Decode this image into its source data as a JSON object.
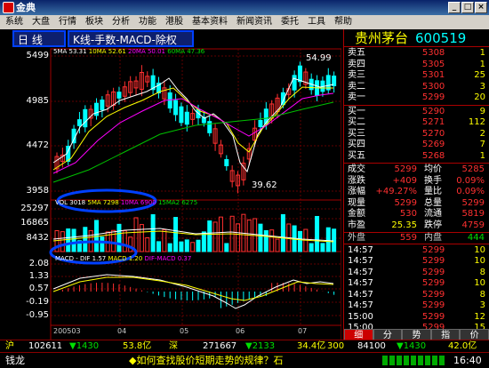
{
  "window": {
    "title": "金典",
    "min": "_",
    "max": "□",
    "close": "×"
  },
  "menu": [
    "系统",
    "大盘",
    "行情",
    "板块",
    "分析",
    "功能",
    "港股",
    "基本资料",
    "新闻资讯",
    "委托",
    "工具",
    "帮助"
  ],
  "chart_header": {
    "period": "日 线",
    "indicator": "K线-手数-MACD-除权"
  },
  "stock": {
    "name": "贵州茅台",
    "code": "600519"
  },
  "price_axis": [
    "5499",
    "4985",
    "4472",
    "3958"
  ],
  "vol_axis": [
    "25297",
    "16865",
    "8432"
  ],
  "macd_axis": [
    "2.08",
    "1.33",
    "0.57",
    "-0.19",
    "-0.95"
  ],
  "ma_legend": {
    "ma5": "5MA 53.31",
    "ma10": "10MA 52.61",
    "ma20": "20MA 50.01",
    "ma60": "60MA 47.36"
  },
  "vol_legend": {
    "vol": "VOL 3018",
    "ma5": "5MA 7298",
    "ma10": "10MA 6900",
    "ma15": "15MA2 6275"
  },
  "macd_legend": {
    "dif": "MACD - DIF 1.57",
    "dea": "MACD 1.20",
    "diff": "DIF-MACD 0.37"
  },
  "marks": {
    "high": "54.99",
    "low": "39.62"
  },
  "date_axis": [
    "200503",
    "04",
    "05",
    "06",
    "07"
  ],
  "ask": [
    {
      "label": "卖五",
      "price": "5308",
      "vol": "1"
    },
    {
      "label": "卖四",
      "price": "5305",
      "vol": "1"
    },
    {
      "label": "卖三",
      "price": "5301",
      "vol": "25"
    },
    {
      "label": "卖二",
      "price": "5300",
      "vol": "3"
    },
    {
      "label": "卖一",
      "price": "5299",
      "vol": "20"
    }
  ],
  "bid": [
    {
      "label": "买一",
      "price": "5290",
      "vol": "9"
    },
    {
      "label": "买二",
      "price": "5271",
      "vol": "112"
    },
    {
      "label": "买三",
      "price": "5270",
      "vol": "2"
    },
    {
      "label": "买四",
      "price": "5269",
      "vol": "7"
    },
    {
      "label": "买五",
      "price": "5268",
      "vol": "1"
    }
  ],
  "stats": [
    {
      "l1": "成交",
      "v1": "5299",
      "l2": "均价",
      "v2": "5285"
    },
    {
      "l1": "涨跌",
      "v1": "+409",
      "l2": "换手",
      "v2": "0.09%"
    },
    {
      "l1": "涨幅",
      "v1": "+49.27%",
      "l2": "量比",
      "v2": "0.09%"
    },
    {
      "l1": "现量",
      "v1": "5299",
      "l2": "总量",
      "v2": "5299"
    },
    {
      "l1": "金额",
      "v1": "530",
      "l2": "流通",
      "v2": "5819"
    },
    {
      "l1": "市盈",
      "v1": "25.35",
      "l2": "跌停",
      "v2": "4759"
    }
  ],
  "outin": {
    "out_label": "外盘",
    "out": "559",
    "in_label": "内盘",
    "in": "444"
  },
  "ticks": [
    {
      "time": "14:57",
      "price": "5299",
      "vol": "10"
    },
    {
      "time": "14:57",
      "price": "5299",
      "vol": "10"
    },
    {
      "time": "14:57",
      "price": "5299",
      "vol": "8"
    },
    {
      "time": "14:57",
      "price": "5299",
      "vol": "10"
    },
    {
      "time": "14:57",
      "price": "5299",
      "vol": "8"
    },
    {
      "time": "14:57",
      "price": "5299",
      "vol": "3"
    },
    {
      "time": "15:00",
      "price": "5299",
      "vol": "12"
    },
    {
      "time": "15:00",
      "price": "5299",
      "vol": "15"
    },
    {
      "time": "15:00",
      "price": "5299",
      "vol": "1"
    }
  ],
  "right_tabs": [
    "细",
    "分",
    "势",
    "指",
    "价"
  ],
  "indexbar": {
    "sh_label": "沪",
    "sh_val": "102611",
    "sh_chg": "▼1430",
    "sh_amt": "53.8亿",
    "sz_label": "深",
    "sz_val": "271667",
    "sz_chg": "▼2133",
    "sz_amt": "34.4亿",
    "c1": "300",
    "c2": "84100",
    "c3": "▼1430",
    "c4": "42.0亿"
  },
  "status": {
    "logo": "钱龙",
    "news": "◆如何查找股价短期走势的规律？石",
    "time": "16:40"
  }
}
